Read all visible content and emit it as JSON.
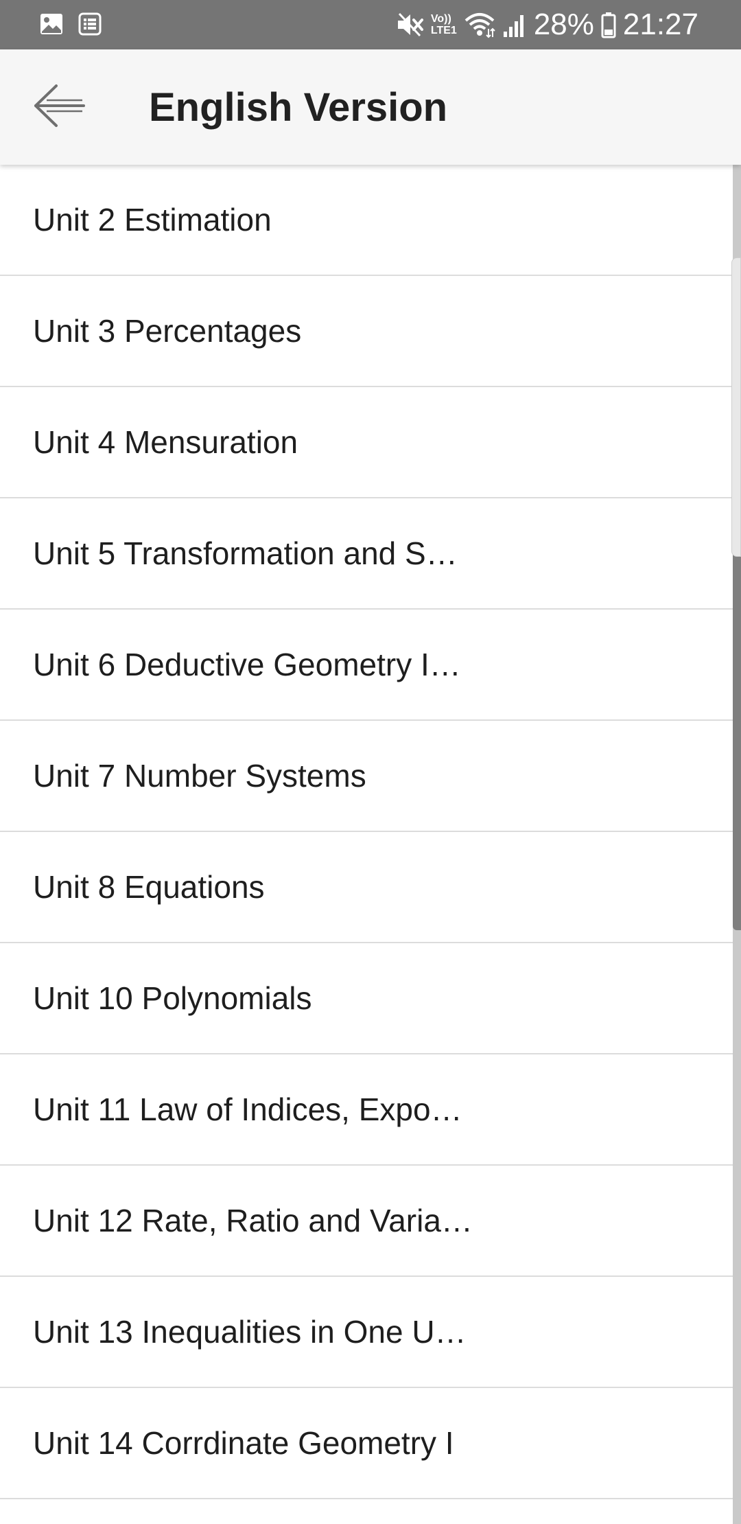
{
  "status_bar": {
    "left_icons": [
      "gallery-icon",
      "news-icon"
    ],
    "right_icons": [
      "mute-icon",
      "volte-icon",
      "wifi-icon",
      "signal-icon",
      "battery-icon"
    ],
    "volte_label": "Vo))",
    "lte_label": "LTE1",
    "battery_percent": "28%",
    "time": "21:27",
    "background_color": "#757575"
  },
  "app_bar": {
    "back_icon": "back-arrow-icon",
    "title": "English Version",
    "background_color": "#f6f6f6"
  },
  "list": {
    "items": [
      {
        "label": "Unit 2 Estimation"
      },
      {
        "label": "Unit 3 Percentages"
      },
      {
        "label": "Unit 4 Mensuration"
      },
      {
        "label": "Unit 5 Transformation and S…"
      },
      {
        "label": "Unit 6 Deductive Geometry I…"
      },
      {
        "label": "Unit 7 Number Systems"
      },
      {
        "label": "Unit 8 Equations"
      },
      {
        "label": "Unit 10 Polynomials"
      },
      {
        "label": "Unit 11 Law of Indices, Expo…"
      },
      {
        "label": "Unit 12 Rate, Ratio and Varia…"
      },
      {
        "label": "Unit 13 Inequalities in One U…"
      },
      {
        "label": "Unit 14 Corrdinate Geometry I"
      }
    ]
  }
}
